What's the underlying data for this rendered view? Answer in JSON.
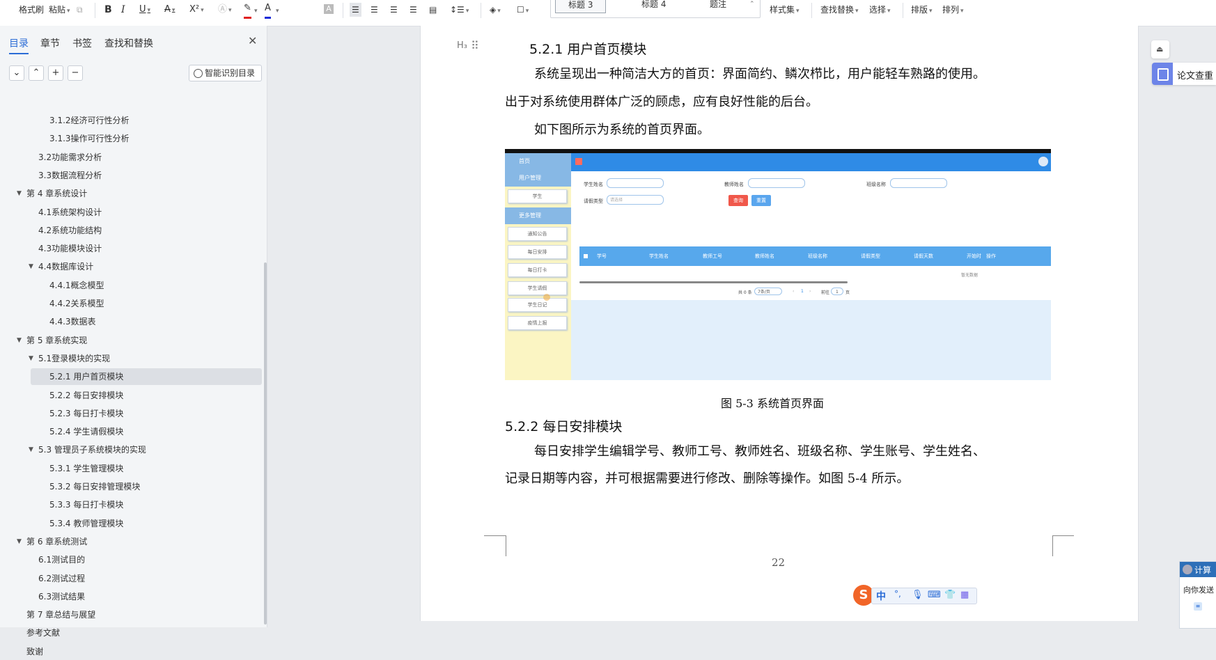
{
  "toolbar": {
    "format_painter": "格式刷",
    "paste": "粘贴",
    "bold": "B",
    "italic": "I",
    "underline": "U",
    "strike": "A",
    "superscript": "X²",
    "font_color_a": "A",
    "style_items": [
      "标题 3",
      "标题 4",
      "题注"
    ],
    "style_set": "样式集",
    "find_replace": "查找替换",
    "select": "选择",
    "layout": "排版",
    "arrange": "排列"
  },
  "sidebar": {
    "tabs": [
      "目录",
      "章节",
      "书签",
      "查找和替换"
    ],
    "smart_toc": "智能识别目录",
    "buttons": [
      "⌄",
      "⌃",
      "+",
      "−"
    ],
    "toc": [
      {
        "text": "3.1.2经济可行性分析",
        "level": 3
      },
      {
        "text": "3.1.3操作可行性分析",
        "level": 3
      },
      {
        "text": "3.2功能需求分析",
        "level": 2
      },
      {
        "text": "3.3数据流程分析",
        "level": 2
      },
      {
        "text": "第 4 章系统设计",
        "level": 1,
        "expanded": true
      },
      {
        "text": "4.1系统架构设计",
        "level": 2
      },
      {
        "text": "4.2系统功能结构",
        "level": 2
      },
      {
        "text": "4.3功能模块设计",
        "level": 2
      },
      {
        "text": "4.4数据库设计",
        "level": 2,
        "expanded": true
      },
      {
        "text": "4.4.1概念模型",
        "level": 3
      },
      {
        "text": "4.4.2关系模型",
        "level": 3
      },
      {
        "text": "4.4.3数据表",
        "level": 3
      },
      {
        "text": "第 5 章系统实现",
        "level": 1,
        "expanded": true
      },
      {
        "text": "5.1登录模块的实现",
        "level": 2,
        "expanded": true
      },
      {
        "text": "5.2.1    用户首页模块",
        "level": 3,
        "selected": true
      },
      {
        "text": "5.2.2 每日安排模块",
        "level": 3
      },
      {
        "text": "5.2.3 每日打卡模块",
        "level": 3
      },
      {
        "text": "5.2.4 学生请假模块",
        "level": 3
      },
      {
        "text": "5.3 管理员子系统模块的实现",
        "level": 2,
        "expanded": true
      },
      {
        "text": "5.3.1 学生管理模块",
        "level": 3
      },
      {
        "text": "5.3.2 每日安排管理模块",
        "level": 3
      },
      {
        "text": "5.3.3 每日打卡模块",
        "level": 3
      },
      {
        "text": "5.3.4 教师管理模块",
        "level": 3
      },
      {
        "text": "第 6 章系统测试",
        "level": 1,
        "expanded": true
      },
      {
        "text": "6.1测试目的",
        "level": 2
      },
      {
        "text": "6.2测试过程",
        "level": 2
      },
      {
        "text": "6.3测试结果",
        "level": 2
      },
      {
        "text": "第 7 章总结与展望",
        "level": 1
      },
      {
        "text": "参考文献",
        "level": 1
      },
      {
        "text": "致谢",
        "level": 1
      }
    ]
  },
  "document": {
    "heading_marker": "H₃",
    "heading_521": "5.2.1    用户首页模块",
    "para1_line1": "系统呈现出一种简洁大方的首页：界面简约、鳞次栉比，用户能轻车熟路的使用。",
    "para1_line2": "出于对系统使用群体广泛的顾虑，应有良好性能的后台。",
    "para2": "如下图所示为系统的首页界面。",
    "caption": "图 5-3 系统首页界面",
    "heading_522": "5.2.2 每日安排模块",
    "para3_line1": "每日安排学生编辑学号、教师工号、教师姓名、班级名称、学生账号、学生姓名、",
    "para3_line2": "记录日期等内容，并可根据需要进行修改、删除等操作。如图 5-4 所示。",
    "page_number": "22"
  },
  "figure": {
    "nav": [
      "首页",
      "用户管理",
      "更多管理"
    ],
    "sub_items": [
      "学生",
      "通知公告",
      "每日安排",
      "每日打卡",
      "学生请假",
      "学生日记",
      "疫情上报"
    ],
    "search_labels": [
      "学生姓名",
      "教师姓名",
      "班级名称",
      "请假类型"
    ],
    "select_placeholder": "请选择",
    "query_button": "查询",
    "reset_button": "重置",
    "columns": [
      "学号",
      "学生姓名",
      "教师工号",
      "教师姓名",
      "班级名称",
      "请假类型",
      "请假天数",
      "开始时",
      "操作"
    ],
    "empty_text": "暂无数据",
    "pager_total": "共 0 条",
    "pager_size": "7条/页",
    "pager_page": "1",
    "pager_goto": "前往",
    "pager_goto_val": "1",
    "pager_unit": "页"
  },
  "right": {
    "plagiarism_check": "论文查重",
    "chat_title": "计算",
    "chat_text": "向你发送"
  },
  "ime": {
    "lang": "中",
    "punct": "°,"
  },
  "colors": {
    "accent": "#2b6cd6",
    "figure_header": "#2f8be6",
    "figure_table_header": "#57a8ec",
    "figure_sidebar": "#fbf5c3",
    "query_red": "#f0584b",
    "reset_blue": "#5aa6ee"
  }
}
